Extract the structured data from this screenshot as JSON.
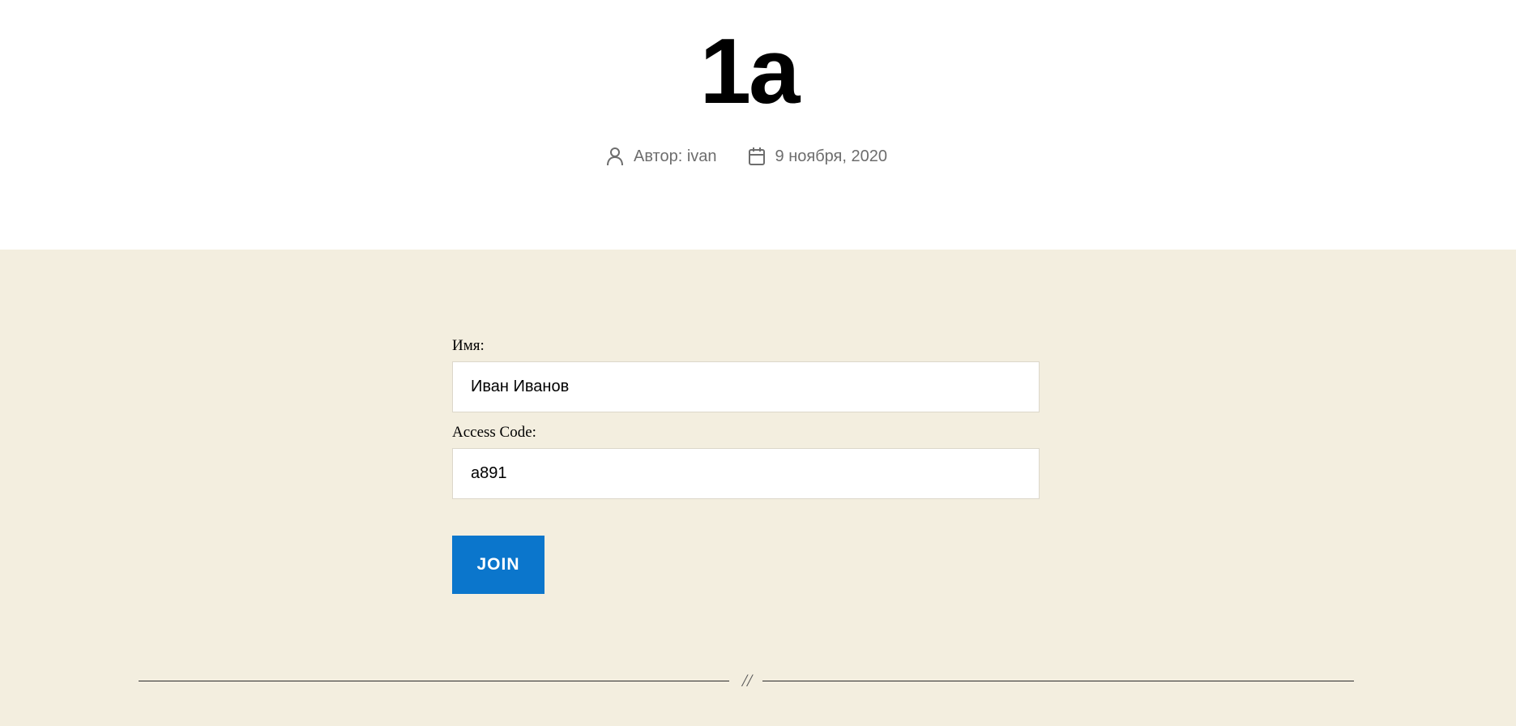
{
  "post": {
    "title": "1a",
    "author_text": "Автор: ivan",
    "date_text": "9 ноября, 2020",
    "author_icon": "user-icon",
    "date_icon": "calendar-icon"
  },
  "form": {
    "name_label": "Имя:",
    "name_value": "Иван Иванов",
    "code_label": "Access Code:",
    "code_value": "a891",
    "join_label": "JOIN"
  },
  "divider": {
    "mark": "//"
  },
  "colors": {
    "header_bg": "#ffffff",
    "content_bg": "#f3eedf",
    "button_bg": "#0b76cc",
    "meta_text": "#6d6d6d"
  }
}
